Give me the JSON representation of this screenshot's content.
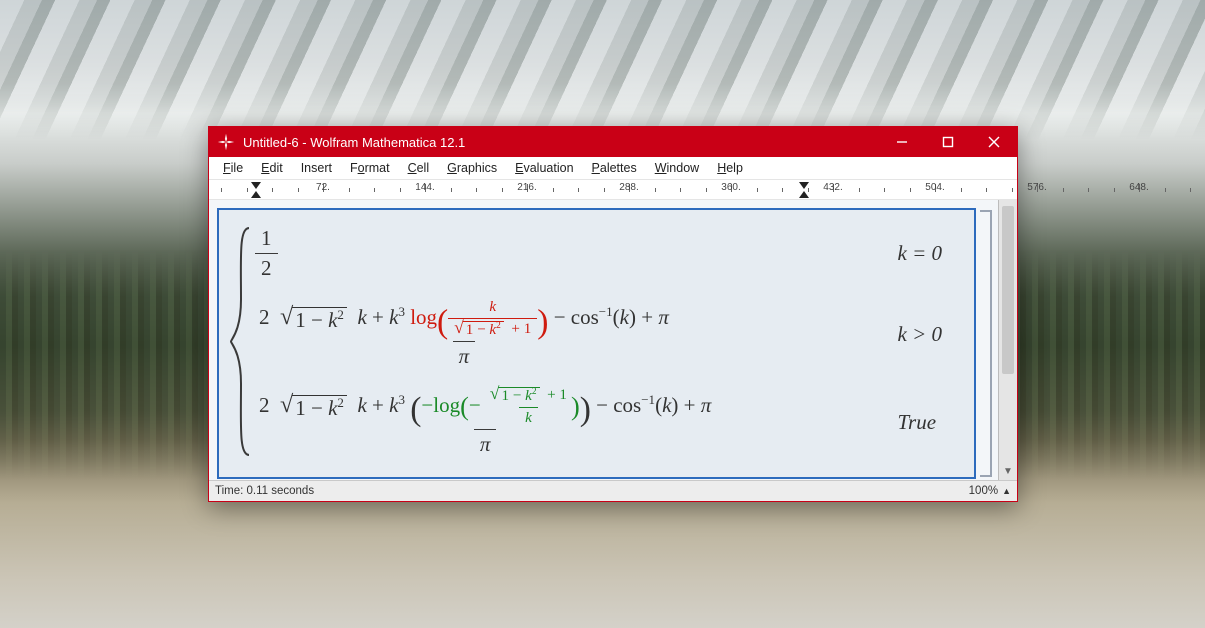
{
  "window": {
    "title": "Untitled-6 - Wolfram Mathematica 12.1",
    "accent_color": "#c90016"
  },
  "menu": {
    "items": [
      {
        "label": "File",
        "mnemonic_index": 0
      },
      {
        "label": "Edit",
        "mnemonic_index": 0
      },
      {
        "label": "Insert",
        "mnemonic_index": -1
      },
      {
        "label": "Format",
        "mnemonic_index": 1
      },
      {
        "label": "Cell",
        "mnemonic_index": 0
      },
      {
        "label": "Graphics",
        "mnemonic_index": 0
      },
      {
        "label": "Evaluation",
        "mnemonic_index": 0
      },
      {
        "label": "Palettes",
        "mnemonic_index": 0
      },
      {
        "label": "Window",
        "mnemonic_index": 0
      },
      {
        "label": "Help",
        "mnemonic_index": 0
      }
    ]
  },
  "ruler": {
    "major_interval": 72,
    "labels": [
      72,
      144,
      216,
      288,
      360,
      432,
      504
    ]
  },
  "status": {
    "timing_label": "Time: 0.11 seconds",
    "zoom_label": "100%"
  },
  "output": {
    "type": "piecewise",
    "cases": [
      {
        "condition_tex": "k = 0",
        "value_description": "1/2"
      },
      {
        "condition_tex": "k > 0",
        "value_description": "(2*sqrt(1 - k^2)*k + k^3*log(k / (sqrt(1 - k^2) + 1)) - arccos(k) + pi) / pi",
        "highlight": {
          "color": "red",
          "part": "log(k / (sqrt(1 - k^2) + 1))"
        }
      },
      {
        "condition_tex": "True",
        "value_description": "(2*sqrt(1 - k^2)*k + k^3*(-log(-(sqrt(1 - k^2) + 1)/k)) - arccos(k) + pi) / pi",
        "highlight": {
          "color": "green",
          "part": "-log(-(sqrt(1 - k^2) + 1)/k)"
        }
      }
    ],
    "symbols": {
      "half_num": "1",
      "half_den": "2",
      "two": "2",
      "one": "1",
      "k": "k",
      "sq": "2",
      "cube": "3",
      "log": "log",
      "minus1": "−1",
      "plus1": "+ 1",
      "cos": "cos",
      "pi": "π",
      "true": "True",
      "eq0": "= 0",
      "gt0": "> 0"
    }
  }
}
